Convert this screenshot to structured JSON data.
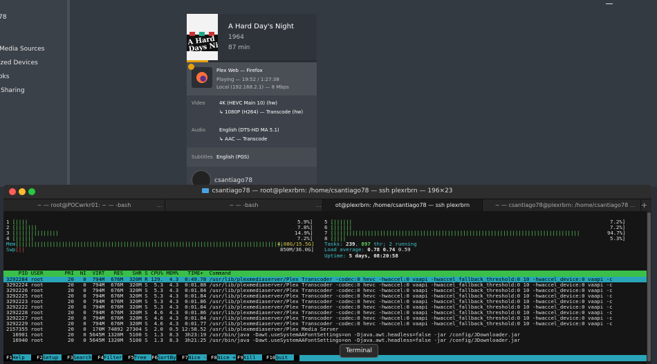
{
  "plex": {
    "sidebar_items": [
      "78",
      "Media Sources",
      "ized Devices",
      "oks",
      "Sharing"
    ],
    "movie": {
      "title": "A Hard Day's Night",
      "year": "1964",
      "duration": "87 min",
      "poster_text": "A Hard\nDays Night",
      "progress_fraction": 0.166
    },
    "player": {
      "name": "Plex Web  —  Firefox",
      "state": "Playing — 19:52 / 1:27:38",
      "local": "Local (192.168.2.1) — 8 Mbps"
    },
    "video": {
      "label": "Video",
      "source": "4K (HEVC Main 10) (hw)",
      "target": "↳  1080P (H264) — Transcode (hw)"
    },
    "audio": {
      "label": "Audio",
      "source": "English (DTS-HD MA 5.1)",
      "target": "↳  AAC — Transcode"
    },
    "subtitles": {
      "label": "Subtitles",
      "value": "English (PGS)"
    },
    "user": "csantiago78"
  },
  "terminal": {
    "title": "csantiago78 — root@plexrbrn: /home/csantiago78 — ssh plexrbrn — 196×23",
    "tabs": [
      {
        "label": "~ — root@POCwrkr01: ~ — -bash"
      },
      {
        "label": "~ — -bash"
      },
      {
        "label": "ot@plexrbrn: /home/csantiago78 — ssh plexrbrn"
      },
      {
        "label": "~ — csantiago78@plexrbrn: /home/csantiago78"
      }
    ],
    "tooltip": "Terminal"
  },
  "htop": {
    "cpus_left": [
      {
        "n": "1",
        "bars": "[||||",
        "pct": "5.9%]"
      },
      {
        "n": "2",
        "bars": "[|||||||",
        "pct": "7.8%]"
      },
      {
        "n": "3",
        "bars": "[||||||||||||||",
        "pct": "14.9%]"
      },
      {
        "n": "4",
        "bars": "[||||||",
        "pct": "7.2%]"
      }
    ],
    "cpus_right": [
      {
        "n": "5",
        "bars": "[||||||",
        "pct": "7.2%]"
      },
      {
        "n": "6",
        "bars": "[||||||",
        "pct": "7.2%]"
      },
      {
        "n": "7",
        "bars": "[||||||||||||||||||||||||||||||||||||||||||||||||||||||||||||||||||||||||||||||||",
        "pct": "94.7%]"
      },
      {
        "n": "8",
        "bars": "[||||",
        "pct": "5.3%]"
      }
    ],
    "mem": {
      "label": "Mem",
      "value": "4.08G/15.5G]"
    },
    "swp": {
      "label": "Swp",
      "value": "850M/36.0G]"
    },
    "tasks": {
      "label": "Tasks: ",
      "tasks": "239",
      "sep": ", ",
      "thr": "897",
      "rest": " thr; 2 running"
    },
    "load": {
      "label": "Load average: ",
      "a": "0.78",
      "b": "0.74",
      "c": "0.59"
    },
    "uptime": {
      "label": "Uptime: ",
      "value": "5 days, 08:20:58"
    },
    "header": "    PID USER       PRI  NI  VIRT   RES   SHR S CPU% MEM%   TIME+  Command",
    "selected_row": "3292284 root        20   0  794M  676M  320M R 129.  4.3  0:49.78 /usr/lib/plexmediaserver/Plex Transcoder -codec:0 hevc -hwaccel:0 vaapi -hwaccel_fallback_threshold:0 10 -hwaccel_device:0 vaapi -c",
    "rows": [
      "3292224 root        20   0  794M  676M  320M S  5.3  4.3  0:01.88 /usr/lib/plexmediaserver/Plex Transcoder -codec:0 hevc -hwaccel:0 vaapi -hwaccel_fallback_threshold:0 10 -hwaccel_device:0 vaapi -c",
      "3292226 root        20   0  794M  676M  320M S  5.3  4.3  0:01.84 /usr/lib/plexmediaserver/Plex Transcoder -codec:0 hevc -hwaccel:0 vaapi -hwaccel_fallback_threshold:0 10 -hwaccel_device:0 vaapi -c",
      "3292225 root        20   0  794M  676M  320M S  5.3  4.3  0:01.84 /usr/lib/plexmediaserver/Plex Transcoder -codec:0 hevc -hwaccel:0 vaapi -hwaccel_fallback_threshold:0 10 -hwaccel_device:0 vaapi -c",
      "3292223 root        20   0  794M  676M  320M S  5.3  4.3  0:01.86 /usr/lib/plexmediaserver/Plex Transcoder -codec:0 hevc -hwaccel:0 vaapi -hwaccel_fallback_threshold:0 10 -hwaccel_device:0 vaapi -c",
      "3292222 root        20   0  794M  676M  320M S  5.3  4.3  0:01.84 /usr/lib/plexmediaserver/Plex Transcoder -codec:0 hevc -hwaccel:0 vaapi -hwaccel_fallback_threshold:0 10 -hwaccel_device:0 vaapi -c",
      "3292228 root        20   0  794M  676M  320M S  4.6  4.3  0:01.86 /usr/lib/plexmediaserver/Plex Transcoder -codec:0 hevc -hwaccel:0 vaapi -hwaccel_fallback_threshold:0 10 -hwaccel_device:0 vaapi -c",
      "3292227 root        20   0  794M  676M  320M S  4.6  4.3  0:01.84 /usr/lib/plexmediaserver/Plex Transcoder -codec:0 hevc -hwaccel:0 vaapi -hwaccel_fallback_threshold:0 10 -hwaccel_device:0 vaapi -c",
      "3292229 root        20   0  794M  676M  320M S  4.6  4.3  0:01.77 /usr/lib/plexmediaserver/Plex Transcoder -codec:0 hevc -hwaccel:0 vaapi -hwaccel_fallback_threshold:0 10 -hwaccel_device:0 vaapi -c",
      "2157355 root        20   0  170M 74892 27304 S  2.0  0.5 12:58.52 /usr/lib/plexmediaserver/Plex Media Server",
      "  16901 root        20   0 5645M 1320M  5100 S  1.3  8.3  3h23:19 /usr/bin/java -Dawt.useSystemAAFontSettings=on -Djava.awt.headless=false -jar /config/JDownloader.jar",
      "  16940 root        20   0 5645M 1320M  5100 S  1.3  8.3  3h21:25 /usr/bin/java -Dawt.useSystemAAFontSettings=on -Djava.awt.headless=false -jar /config/JDownloader.jar"
    ],
    "fkeys": [
      {
        "k": "F1",
        "d": "Help  "
      },
      {
        "k": "F2",
        "d": "Setup "
      },
      {
        "k": "F3",
        "d": "Search"
      },
      {
        "k": "F4",
        "d": "Filter"
      },
      {
        "k": "F5",
        "d": "Tree  "
      },
      {
        "k": "F6",
        "d": "SortBy"
      },
      {
        "k": "F7",
        "d": "Nice -"
      },
      {
        "k": "F8",
        "d": "Nice +"
      },
      {
        "k": "F9",
        "d": "Kill  "
      },
      {
        "k": "F10",
        "d": "Quit  "
      }
    ]
  },
  "colors": {
    "plex_accent": "#e5a00d",
    "htop_header": "#3ac04a",
    "htop_select": "#2aa4b8"
  }
}
